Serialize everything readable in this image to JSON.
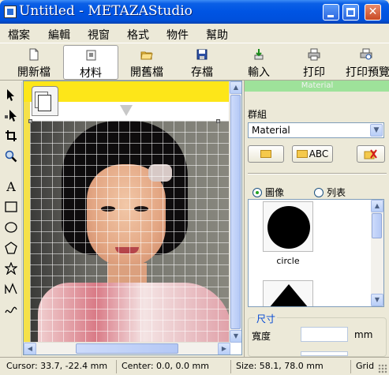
{
  "window": {
    "title": "Untitled - METAZAStudio",
    "min": "",
    "max": "",
    "close": "✕"
  },
  "menu": [
    "檔案",
    "編輯",
    "視窗",
    "格式",
    "物件",
    "幫助"
  ],
  "toolbar": {
    "new": "開新檔",
    "material": "材料",
    "open": "開舊檔",
    "save": "存檔",
    "import": "輸入",
    "print": "打印",
    "print_preview": "打印預覽"
  },
  "palette_icons": [
    "pointer-icon",
    "node-edit-icon",
    "crop-icon",
    "zoom-icon",
    "text-icon",
    "rectangle-icon",
    "ellipse-icon",
    "pentagon-icon",
    "star-icon",
    "curve-icon",
    "freehand-icon"
  ],
  "panel": {
    "title": "Material",
    "group_label": "群組",
    "group_value": "Material",
    "button_rename": "ABC",
    "view_image": "圖像",
    "view_list": "列表",
    "gallery": [
      {
        "caption": "circle"
      },
      {
        "caption": ""
      }
    ],
    "size_legend": "尺寸",
    "width_label": "寬度",
    "unit": "mm"
  },
  "status": {
    "cursor": "Cursor: 33.7, -22.4 mm",
    "center": "Center: 0.0, 0.0 mm",
    "size": "Size: 58.1, 78.0 mm",
    "grid": "Grid"
  },
  "colors": {
    "titlebar": "#0054e3",
    "ruler": "#fde619",
    "panel_title": "#9ee29a"
  }
}
